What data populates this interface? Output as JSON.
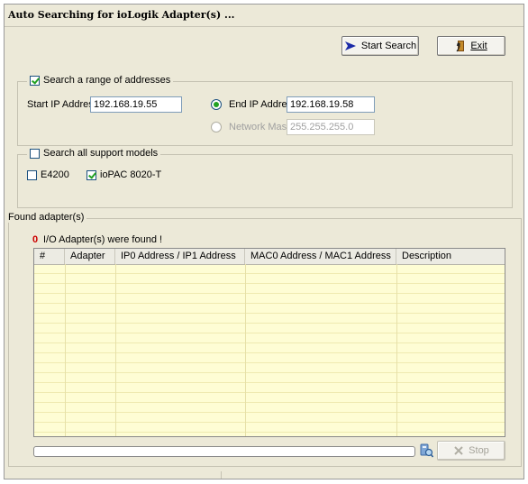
{
  "window": {
    "title": "Auto Searching for ioLogik Adapter(s) ..."
  },
  "toolbar": {
    "start_search": "Start Search",
    "exit": "Exit"
  },
  "range": {
    "checkbox_label": "Search a range of addresses",
    "checked": true,
    "start_ip_label": "Start IP Address:",
    "start_ip_value": "192.168.19.55",
    "end_ip_label": "End IP Address:",
    "end_ip_value": "192.168.19.58",
    "mask_label": "Network Mask:",
    "mask_value": "255.255.255.0"
  },
  "models": {
    "checkbox_label": "Search all support models",
    "checked": false,
    "items": [
      {
        "label": "E4200",
        "checked": false
      },
      {
        "label": "ioPAC 8020-T",
        "checked": true
      }
    ]
  },
  "found": {
    "legend": "Found adapter(s)",
    "count": "0",
    "count_text": "I/O Adapter(s) were found !",
    "columns": [
      "#",
      "Adapter",
      "IP0 Address / IP1 Address",
      "MAC0 Address / MAC1 Address",
      "Description"
    ]
  },
  "footer": {
    "stop": "Stop"
  },
  "colors": {
    "check": "#21a121",
    "count": "#cc0000",
    "table_bg": "#fefdd4"
  }
}
